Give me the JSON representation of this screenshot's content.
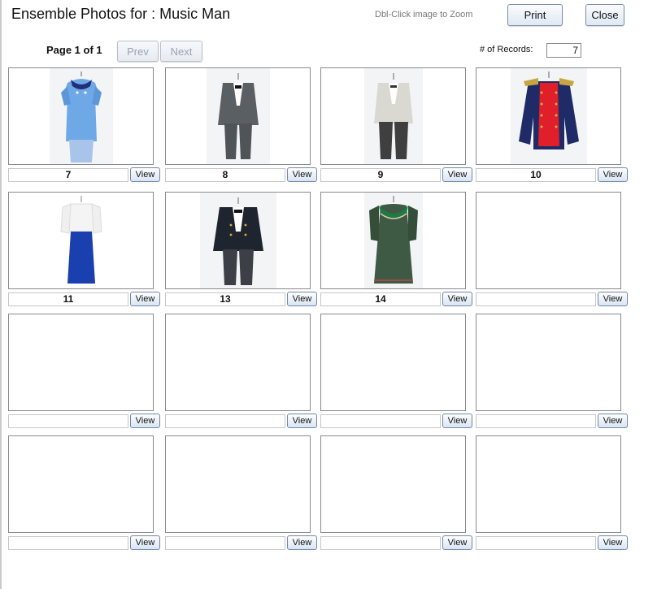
{
  "header": {
    "title": "Ensemble Photos for : Music Man",
    "hint": "Dbl-Click image to Zoom",
    "print_label": "Print",
    "close_label": "Close"
  },
  "pager": {
    "page_text": "Page 1 of 1",
    "prev_label": "Prev",
    "next_label": "Next",
    "records_label": "# of Records:",
    "records_value": "7"
  },
  "view_label": "View",
  "tiles": [
    {
      "caption": "7",
      "image": "blue-dress"
    },
    {
      "caption": "8",
      "image": "gray-suit"
    },
    {
      "caption": "9",
      "image": "light-suit"
    },
    {
      "caption": "10",
      "image": "band-jacket"
    },
    {
      "caption": "11",
      "image": "white-blouse-blue-skirt"
    },
    {
      "caption": "13",
      "image": "dark-suit-gold-buttons"
    },
    {
      "caption": "14",
      "image": "green-dress"
    },
    {
      "caption": "",
      "image": ""
    },
    {
      "caption": "",
      "image": ""
    },
    {
      "caption": "",
      "image": ""
    },
    {
      "caption": "",
      "image": ""
    },
    {
      "caption": "",
      "image": ""
    },
    {
      "caption": "",
      "image": ""
    },
    {
      "caption": "",
      "image": ""
    },
    {
      "caption": "",
      "image": ""
    },
    {
      "caption": "",
      "image": ""
    }
  ]
}
